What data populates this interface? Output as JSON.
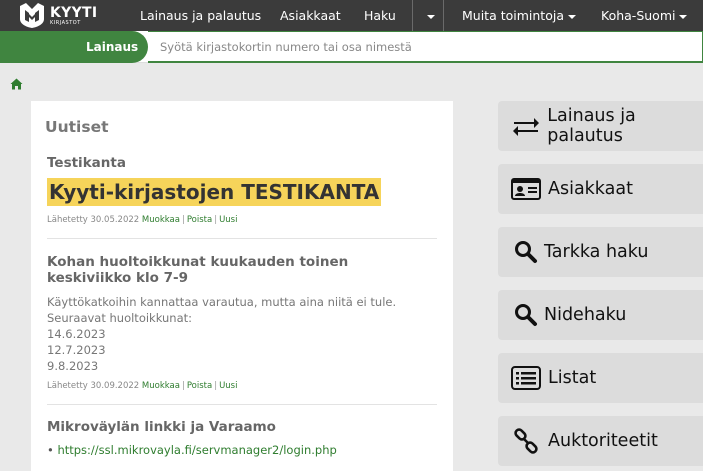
{
  "brand": {
    "name": "KYYTI",
    "sub": "KIRJASTOT"
  },
  "topnav": {
    "items": [
      "Lainaus ja palautus",
      "Asiakkaat",
      "Haku",
      "Muita toimintoja",
      "Koha-Suomi"
    ]
  },
  "search": {
    "tab_label": "Lainaus",
    "placeholder": "Syötä kirjastokortin numero tai osa nimestä"
  },
  "news": {
    "title": "Uutiset",
    "items": [
      {
        "heading": "Testikanta",
        "highlight": "Kyyti-kirjastojen TESTIKANTA",
        "posted": "Lähetetty 30.05.2022",
        "actions": [
          "Muokkaa",
          "Poista",
          "Uusi"
        ]
      },
      {
        "heading": "Kohan huoltoikkunat kuukauden toinen keskiviikko klo 7-9",
        "body": [
          "Käyttökatkoihin kannattaa varautua, mutta aina niitä ei tule.",
          "Seuraavat huoltoikkunat:",
          "14.6.2023",
          "12.7.2023",
          "9.8.2023"
        ],
        "posted": "Lähetetty 30.09.2022",
        "actions": [
          "Muokkaa",
          "Poista",
          "Uusi"
        ]
      },
      {
        "heading": "Mikroväylän linkki ja Varaamo",
        "link": "https://ssl.mikrovayla.fi/servmanager2/login.php"
      }
    ]
  },
  "shortcuts": [
    "Lainaus ja palautus",
    "Asiakkaat",
    "Tarkka haku",
    "Nidehaku",
    "Listat",
    "Auktoriteetit"
  ],
  "colors": {
    "accent": "#408540",
    "nav": "#3b3b3b",
    "highlight": "#f6d45a"
  }
}
